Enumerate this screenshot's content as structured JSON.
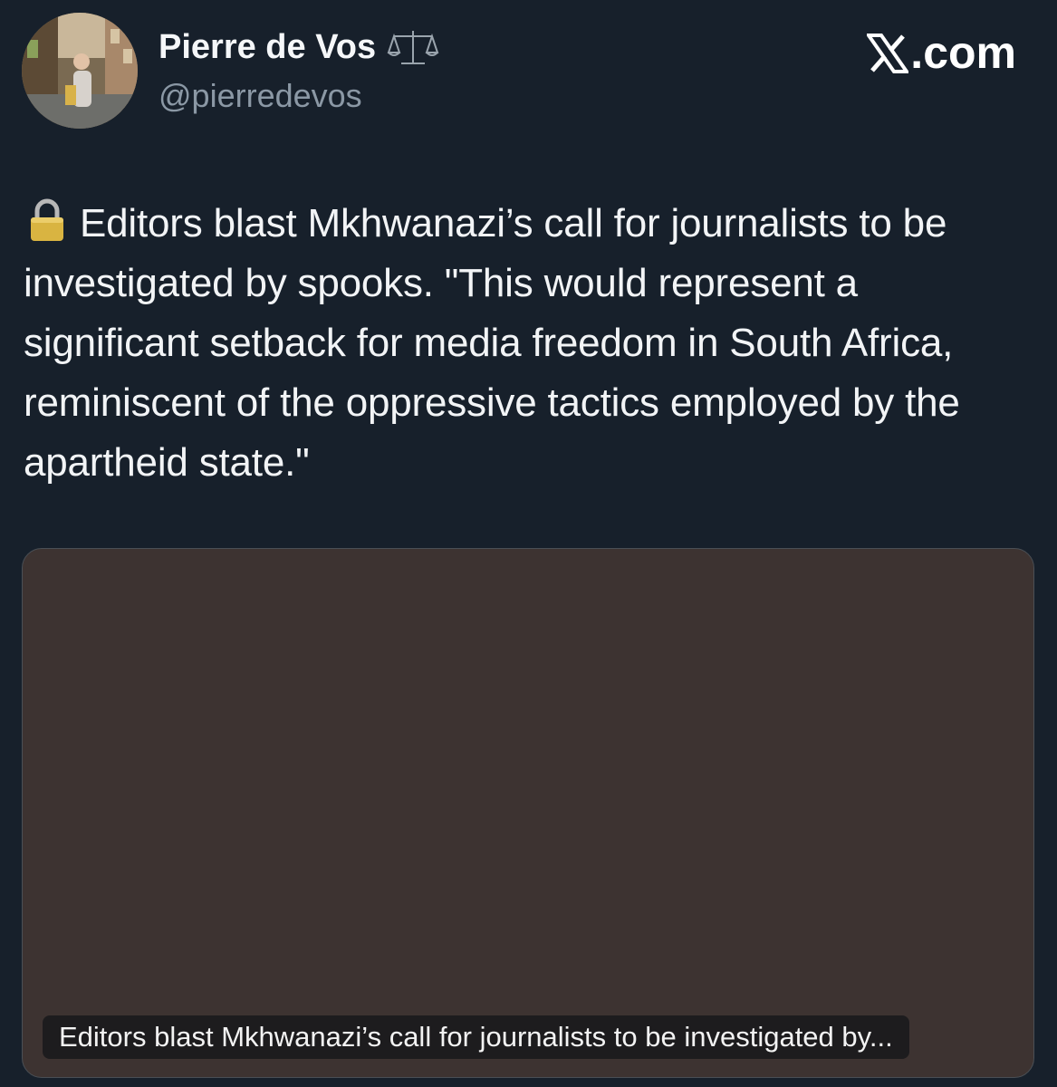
{
  "author": {
    "display_name": "Pierre de Vos",
    "handle": "@pierredevos",
    "badge_icon": "balance-scale-icon",
    "avatar_icon": "profile-photo"
  },
  "brand": {
    "site": ".com",
    "logo_icon": "x-logo-icon"
  },
  "tweet": {
    "emoji_icon": "lock-icon",
    "text": "Editors blast Mkhwanazi’s call for journalists to be investigated by spooks. \"This would represent a significant setback for media freedom in South Africa, reminiscent of the oppressive tactics employed by the apartheid state.\""
  },
  "link_card": {
    "caption": "Editors blast Mkhwanazi’s call for journalists to be investigated by...",
    "background": "#3d3331"
  },
  "colors": {
    "background": "#17202b",
    "text": "#f2f4f6",
    "secondary": "#8b98a5"
  }
}
